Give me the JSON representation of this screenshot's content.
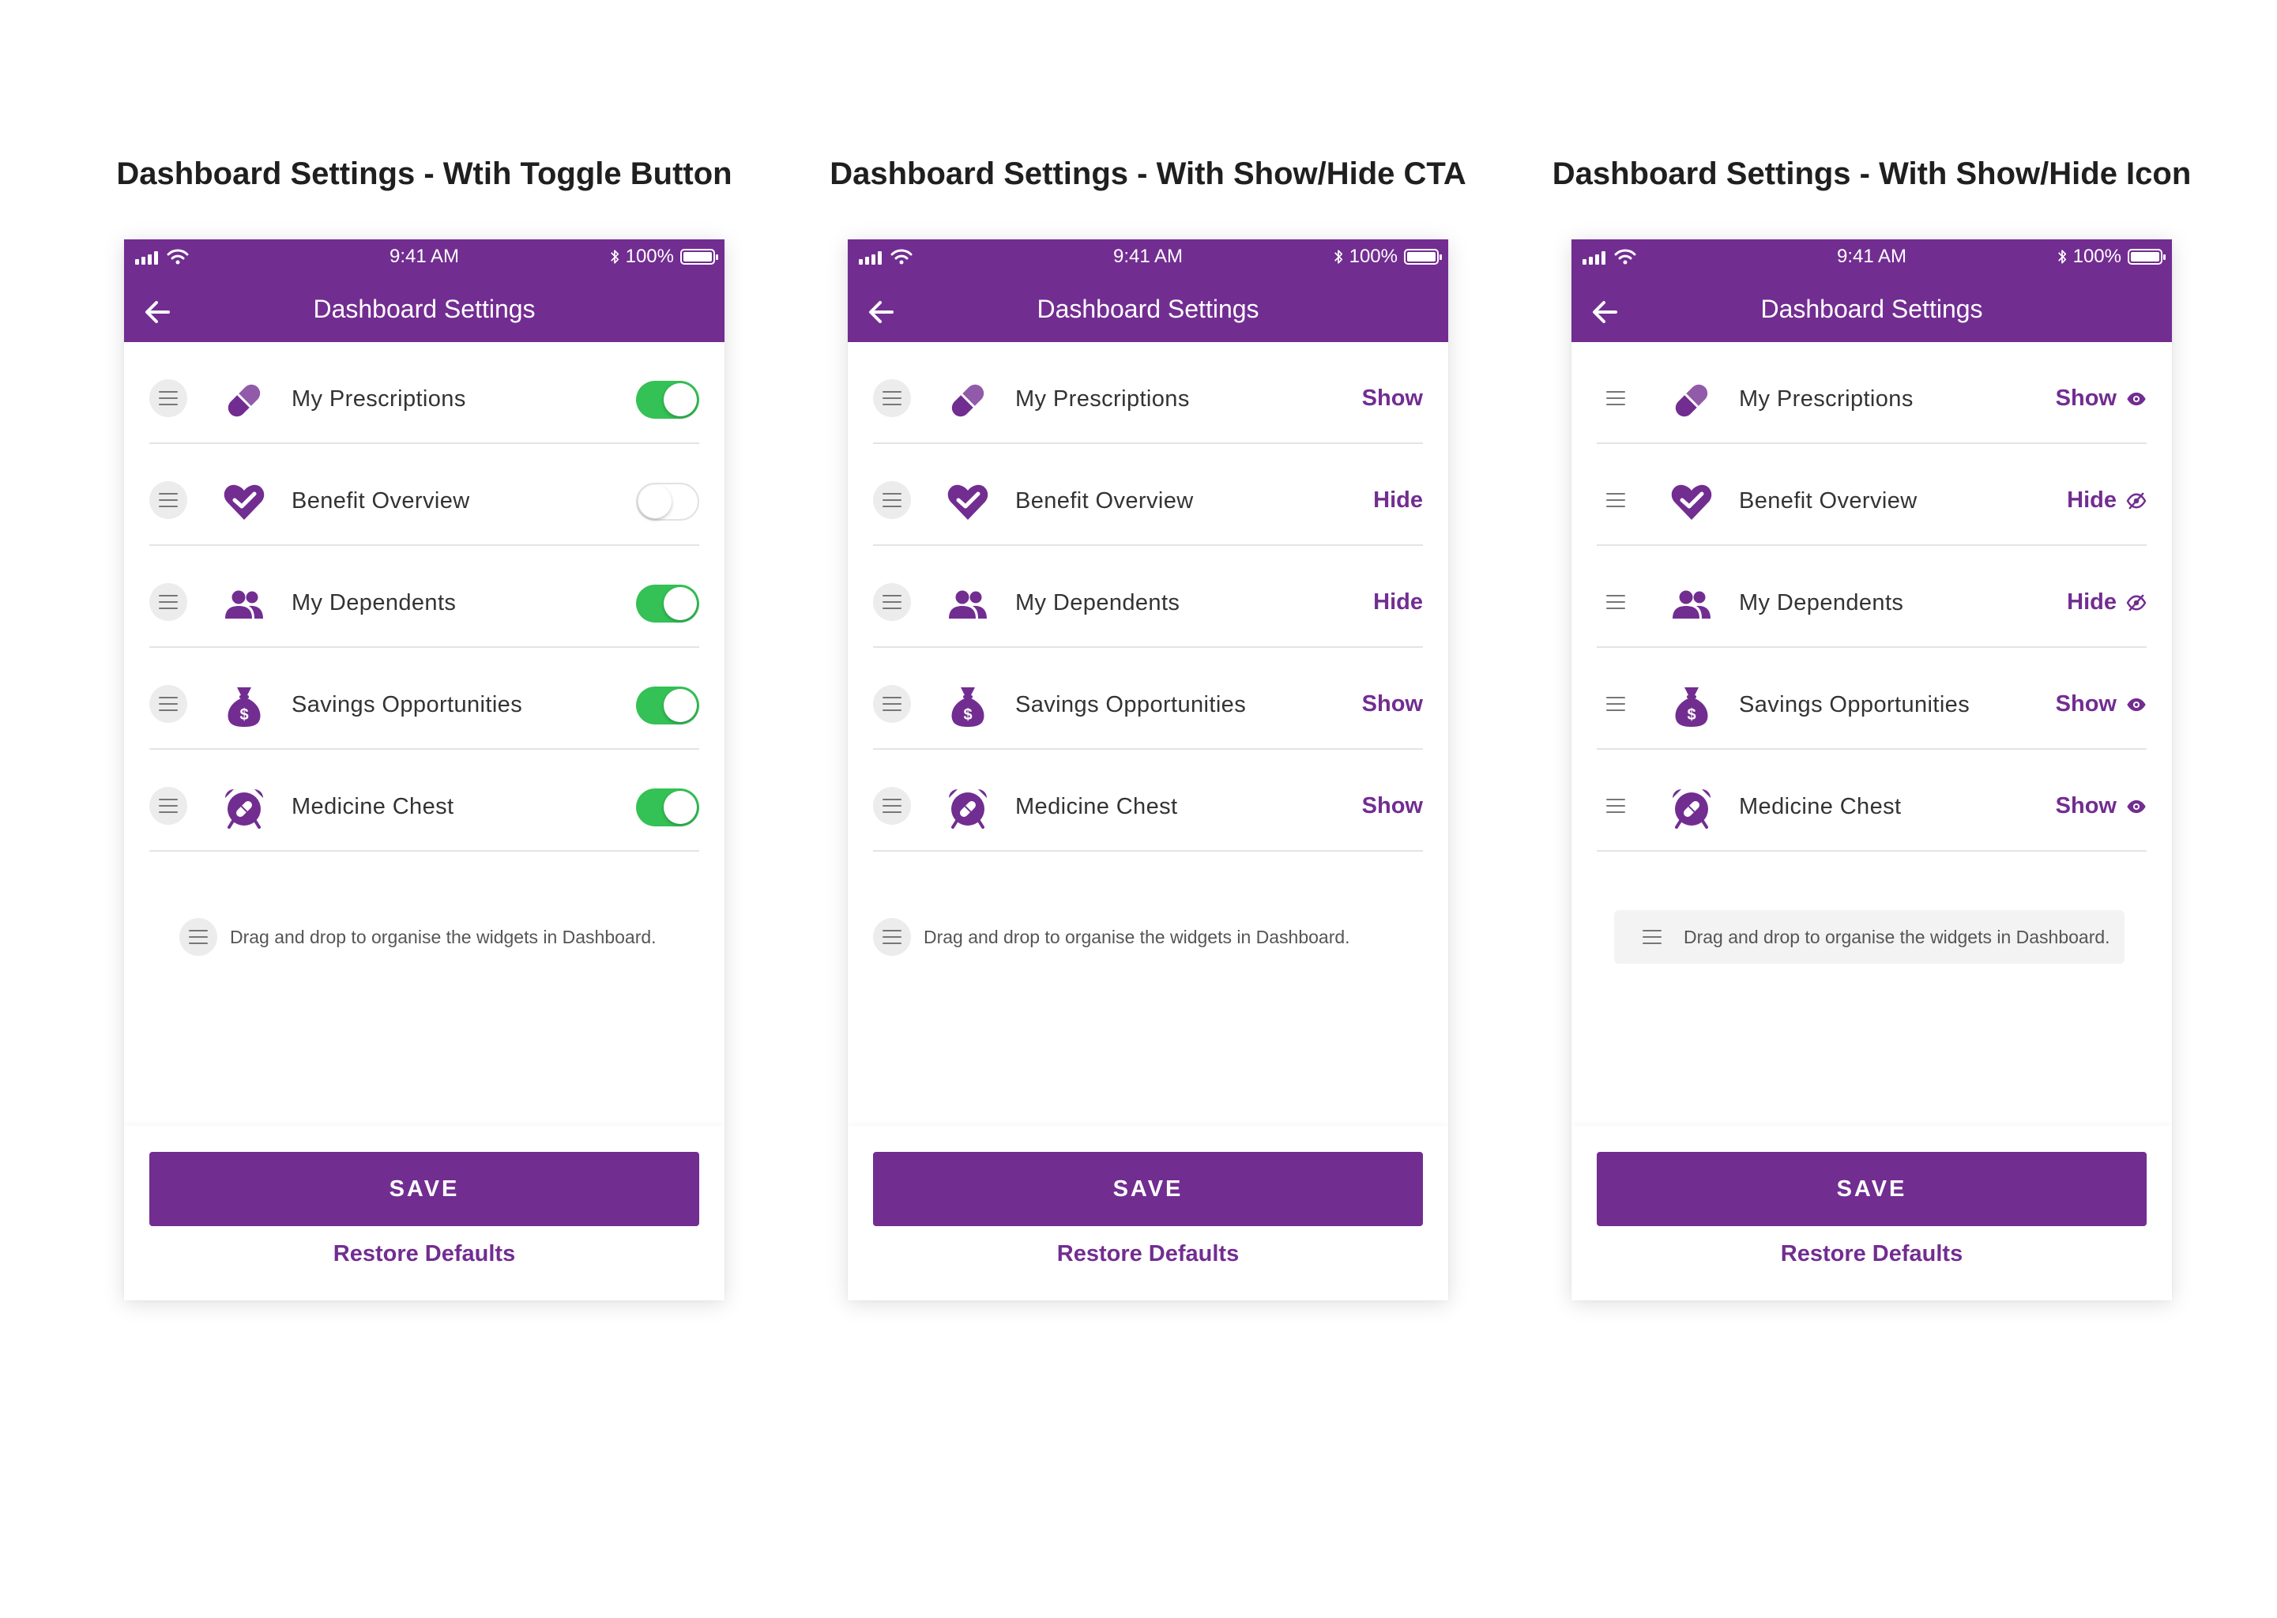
{
  "colors": {
    "brand": "#722D91",
    "toggle_on": "#34C155",
    "divider": "#E4E4E4"
  },
  "variants": [
    {
      "title": "Dashboard Settings - Wtih Toggle Button",
      "control": "toggle",
      "status": {
        "time": "9:41 AM",
        "battery": "100%"
      },
      "header": {
        "title": "Dashboard Settings",
        "back_icon": "arrow-left-icon"
      },
      "items": [
        {
          "label": "My Prescriptions",
          "icon": "pill-icon",
          "enabled": true
        },
        {
          "label": "Benefit Overview",
          "icon": "heart-check-icon",
          "enabled": false
        },
        {
          "label": "My Dependents",
          "icon": "people-icon",
          "enabled": true
        },
        {
          "label": "Savings Opportunities",
          "icon": "money-bag-icon",
          "enabled": true
        },
        {
          "label": "Medicine Chest",
          "icon": "alarm-clock-pill-icon",
          "enabled": true
        }
      ],
      "hint": "Drag and drop to organise the widgets in Dashboard.",
      "save_label": "SAVE",
      "restore_label": "Restore Defaults"
    },
    {
      "title": "Dashboard Settings - With Show/Hide CTA",
      "control": "cta",
      "status": {
        "time": "9:41 AM",
        "battery": "100%"
      },
      "header": {
        "title": "Dashboard Settings",
        "back_icon": "arrow-left-icon"
      },
      "items": [
        {
          "label": "My Prescriptions",
          "icon": "pill-icon",
          "action": "Show"
        },
        {
          "label": "Benefit Overview",
          "icon": "heart-check-icon",
          "action": "Hide"
        },
        {
          "label": "My Dependents",
          "icon": "people-icon",
          "action": "Hide"
        },
        {
          "label": "Savings Opportunities",
          "icon": "money-bag-icon",
          "action": "Show"
        },
        {
          "label": "Medicine Chest",
          "icon": "alarm-clock-pill-icon",
          "action": "Show"
        }
      ],
      "hint": "Drag and drop to organise the widgets in Dashboard.",
      "save_label": "SAVE",
      "restore_label": "Restore Defaults"
    },
    {
      "title": "Dashboard Settings - With Show/Hide Icon",
      "control": "cta-icon",
      "status": {
        "time": "9:41 AM",
        "battery": "100%"
      },
      "header": {
        "title": "Dashboard Settings",
        "back_icon": "arrow-left-icon"
      },
      "items": [
        {
          "label": "My Prescriptions",
          "icon": "pill-icon",
          "action": "Show",
          "action_icon": "eye-icon"
        },
        {
          "label": "Benefit Overview",
          "icon": "heart-check-icon",
          "action": "Hide",
          "action_icon": "eye-slash-icon"
        },
        {
          "label": "My Dependents",
          "icon": "people-icon",
          "action": "Hide",
          "action_icon": "eye-slash-icon"
        },
        {
          "label": "Savings Opportunities",
          "icon": "money-bag-icon",
          "action": "Show",
          "action_icon": "eye-icon"
        },
        {
          "label": "Medicine Chest",
          "icon": "alarm-clock-pill-icon",
          "action": "Show",
          "action_icon": "eye-icon"
        }
      ],
      "hint": "Drag and drop to organise the widgets in Dashboard.",
      "save_label": "SAVE",
      "restore_label": "Restore Defaults"
    }
  ]
}
